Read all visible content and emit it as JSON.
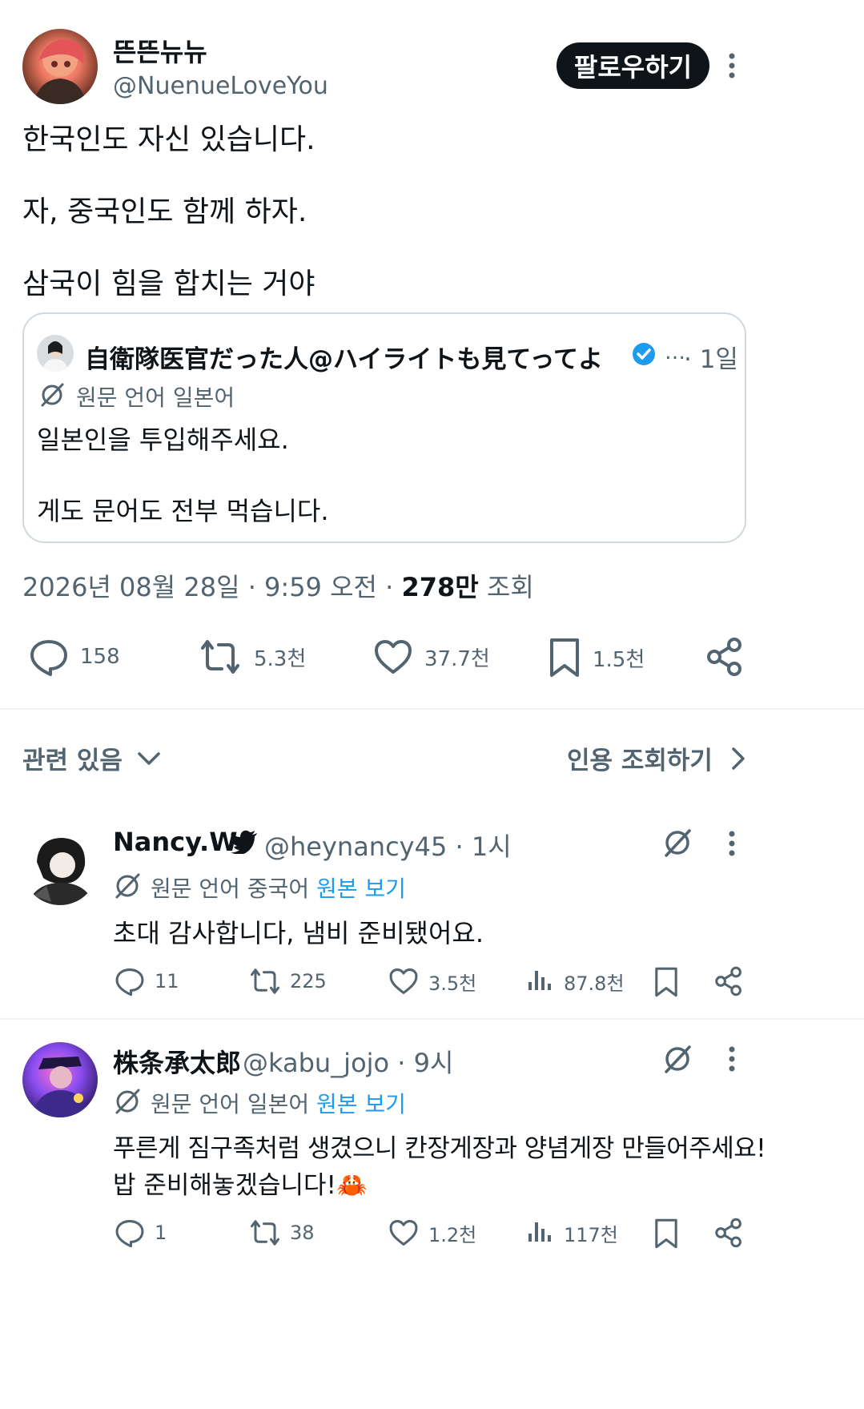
{
  "tweet": {
    "display_name": "뜬뜬뉴뉴",
    "handle": "@NuenueLoveYou",
    "follow_label": "팔로우하기",
    "lines": [
      "한국인도 자신 있습니다.",
      "자, 중국인도 함께 하자.",
      "삼국이 힘을 합치는 거야"
    ],
    "quote": {
      "display_name": "自衛隊医官だった人@ハイライトも見てってよ",
      "ellipsis": "…",
      "time": "· 1일",
      "translate_label": "원문 언어 일본어",
      "lines": [
        "일본인을 투입해주세요.",
        "게도 문어도 전부 먹습니다."
      ]
    },
    "timestamp": "2026년 08월 28일 · 9:59 오전 ·",
    "views_count": "278만",
    "views_label": "조회",
    "stats": {
      "replies": "158",
      "retweets": "5.3천",
      "likes": "37.7천",
      "bookmarks": "1.5천"
    }
  },
  "replies_header": {
    "sort_label": "관련 있음",
    "quotes_label": "인용 조회하기"
  },
  "replies": [
    {
      "display_name": "Nancy.W",
      "handle_time": "@heynancy45 · 1시",
      "translate_label": "원문 언어 중국어",
      "show_original": "원본 보기",
      "lines": [
        "초대 감사합니다, 냄비 준비됐어요."
      ],
      "stats": {
        "replies": "11",
        "retweets": "225",
        "likes": "3.5천",
        "views": "87.8천"
      }
    },
    {
      "display_name": "株条承太郎",
      "handle_time": "@kabu_jojo · 9시",
      "translate_label": "원문 언어 일본어",
      "show_original": "원본 보기",
      "lines": [
        "푸른게 짐구족처럼 생겼으니 칸장게장과 양념게장 만들어주세요!",
        "밥 준비해놓겠습니다!🦀"
      ],
      "stats": {
        "replies": "1",
        "retweets": "38",
        "likes": "1.2천",
        "views": "117천"
      }
    }
  ],
  "colors": {
    "text": "#0f1419",
    "secondary": "#536471",
    "link": "#1d9bf0",
    "verified": "#1d9bf0",
    "divider": "#eff3f4"
  },
  "icons": [
    "reply-icon",
    "retweet-icon",
    "like-icon",
    "bookmark-icon",
    "share-icon",
    "views-icon",
    "more-icon",
    "translate-icon",
    "verified-badge-icon",
    "bird-icon",
    "chevron-down-icon",
    "chevron-right-icon"
  ]
}
